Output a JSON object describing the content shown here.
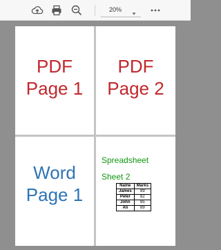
{
  "toolbar": {
    "zoom_value": "20%",
    "icons": [
      "cloud-upload-icon",
      "print-icon",
      "zoom-out-icon",
      "more-options-icon"
    ]
  },
  "pages": {
    "p1": {
      "line1": "PDF",
      "line2": "Page 1",
      "color": "#c0282d"
    },
    "p2": {
      "line1": "PDF",
      "line2": "Page 2",
      "color": "#c0282d"
    },
    "p3": {
      "line1": "Word",
      "line2": "Page 1",
      "color": "#2e74b5"
    },
    "p4": {
      "title": "Spreadsheet",
      "subtitle": "Sheet 2",
      "color": "#109610",
      "table": {
        "headers": [
          "Name",
          "Marks"
        ],
        "rows": [
          [
            "James",
            "89"
          ],
          [
            "Peter",
            "82"
          ],
          [
            "John",
            "85"
          ],
          [
            "Ali",
            "89"
          ]
        ]
      }
    }
  }
}
